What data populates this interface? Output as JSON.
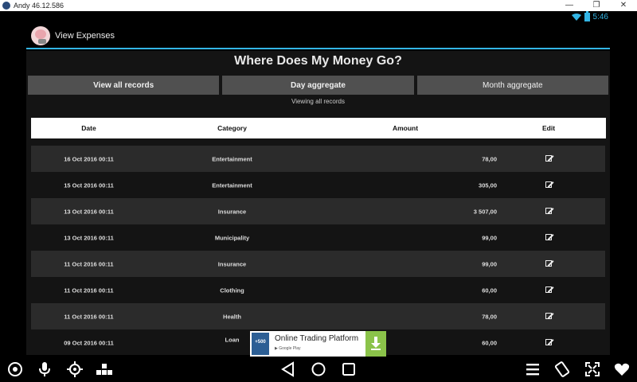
{
  "window": {
    "title": "Andy 46.12.586"
  },
  "status_bar": {
    "time": "5:46"
  },
  "app_bar": {
    "title": "View Expenses"
  },
  "main": {
    "heading": "Where Does My Money Go?",
    "buttons": {
      "view_all": "View all records",
      "day_aggregate": "Day aggregate",
      "month_aggregate": "Month aggregate"
    },
    "view_status": "Viewing all records",
    "table": {
      "headers": {
        "date": "Date",
        "category": "Category",
        "amount": "Amount",
        "edit": "Edit"
      },
      "rows": [
        {
          "date": "16 Oct 2016 00:11",
          "category": "Entertainment",
          "amount": "78,00"
        },
        {
          "date": "15 Oct 2016 00:11",
          "category": "Entertainment",
          "amount": "305,00"
        },
        {
          "date": "13 Oct 2016 00:11",
          "category": "Insurance",
          "amount": "3 507,00"
        },
        {
          "date": "13 Oct 2016 00:11",
          "category": "Municipality",
          "amount": "99,00"
        },
        {
          "date": "11 Oct 2016 00:11",
          "category": "Insurance",
          "amount": "99,00"
        },
        {
          "date": "11 Oct 2016 00:11",
          "category": "Clothing",
          "amount": "60,00"
        },
        {
          "date": "11 Oct 2016 00:11",
          "category": "Health",
          "amount": "78,00"
        },
        {
          "date": "09 Oct 2016 00:11",
          "category": "Loan",
          "amount": "60,00"
        }
      ]
    }
  },
  "ad": {
    "title": "Online Trading Platform",
    "store": "Google Play",
    "badge": "+500"
  },
  "colors": {
    "accent": "#33b5e5",
    "button_bg": "#505050",
    "row_alt": "#2b2b2b",
    "ad_download": "#8bc34a"
  }
}
